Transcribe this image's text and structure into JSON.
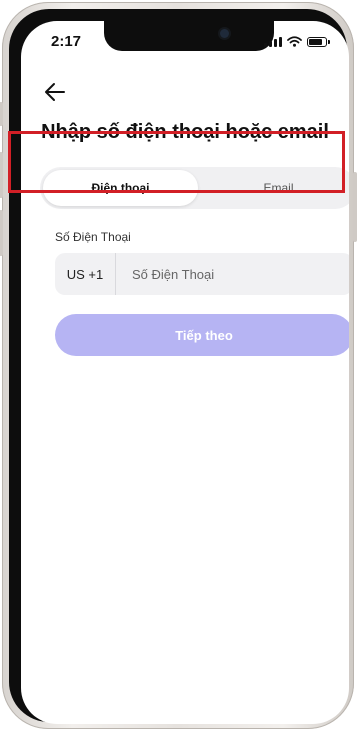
{
  "status_bar": {
    "time": "2:17",
    "battery_level": 0.85
  },
  "header": {
    "back_icon": "arrow-left-icon",
    "title": "Nhập số điện thoại hoặc email"
  },
  "tabs": [
    {
      "label": "Điện thoại",
      "active": true
    },
    {
      "label": "Email",
      "active": false
    }
  ],
  "form": {
    "phone_label": "Số Điện Thoại",
    "country_code": "US +1",
    "phone_placeholder": "Số Điện Thoại",
    "phone_value": ""
  },
  "actions": {
    "next_label": "Tiếp theo"
  },
  "colors": {
    "highlight": "#d21f26",
    "primary_disabled": "#b6b4f3",
    "field_bg": "#f1f1f3"
  }
}
